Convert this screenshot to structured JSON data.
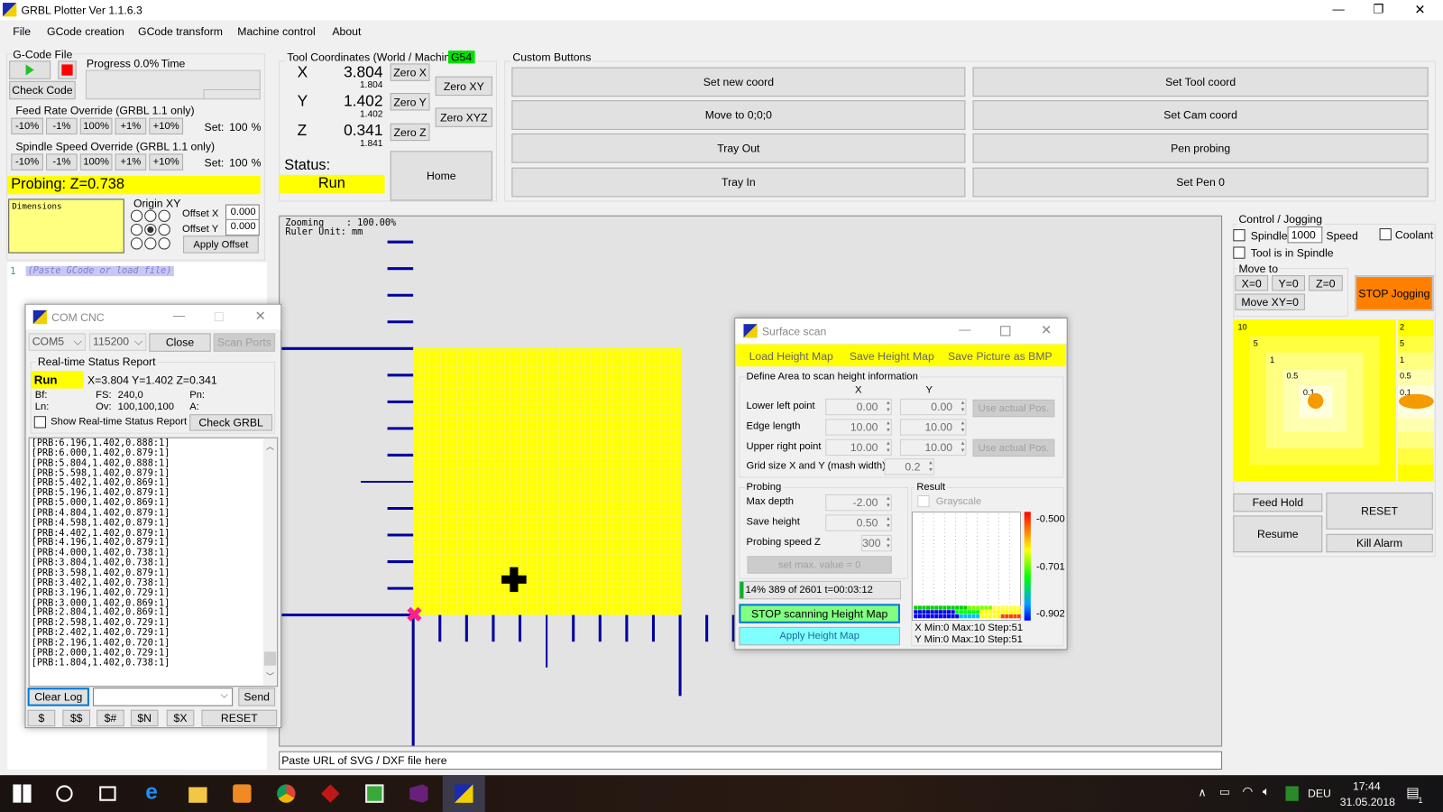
{
  "app": {
    "title": "GRBL Plotter Ver 1.1.6.3",
    "minimize": "—",
    "maximize": "❐",
    "close": "✕"
  },
  "menu": [
    "File",
    "GCode creation",
    "GCode transform",
    "Machine control",
    "About"
  ],
  "gcode": {
    "group": "G-Code File",
    "check_code": "Check Code",
    "progress": "Progress 0.0%",
    "time": "Time"
  },
  "feed": {
    "title": "Feed Rate Override (GRBL 1.1 only)",
    "buttons": [
      "-10%",
      "-1%",
      "100%",
      "+1%",
      "+10%"
    ],
    "set_label": "Set:",
    "set_value": "100",
    "unit": "%"
  },
  "spindle": {
    "title": "Spindle Speed Override (GRBL 1.1 only)",
    "buttons": [
      "-10%",
      "-1%",
      "100%",
      "+1%",
      "+10%"
    ],
    "set_label": "Set:",
    "set_value": "100",
    "unit": "%"
  },
  "probing_status": "Probing: Z=0.738",
  "dimensions": "Dimensions",
  "origin": {
    "title": "Origin XY",
    "selected": 4,
    "offset_x_label": "Offset X",
    "offset_x": "0.000",
    "offset_y_label": "Offset Y",
    "offset_y": "0.000",
    "apply": "Apply Offset"
  },
  "editor": {
    "line_no": "1",
    "placeholder": "(Paste GCode or load file)"
  },
  "tool": {
    "title": "Tool Coordinates (World / Machine)",
    "cs": "G54",
    "x_label": "X",
    "x_world": "3.804",
    "x_machine": "1.804",
    "y_label": "Y",
    "y_world": "1.402",
    "y_machine": "1.402",
    "z_label": "Z",
    "z_world": "0.341",
    "z_machine": "1.841",
    "zero_x": "Zero X",
    "zero_y": "Zero Y",
    "zero_z": "Zero Z",
    "zero_xy": "Zero XY",
    "zero_xyz": "Zero XYZ",
    "status_label": "Status:",
    "status": "Run",
    "home": "Home"
  },
  "custom": {
    "title": "Custom Buttons",
    "buttons": [
      "Set new coord",
      "Set Tool coord",
      "Move to 0;0;0",
      "Set Cam coord",
      "Tray Out",
      "Pen probing",
      "Tray In",
      "Set Pen 0"
    ]
  },
  "canvas": {
    "info1": "Zooming    : 100.00%",
    "info2": "Ruler Unit: mm",
    "url_placeholder": "Paste URL of SVG / DXF file here"
  },
  "com": {
    "title": "COM CNC",
    "port": "COM5",
    "baud": "115200",
    "close": "Close",
    "scan": "Scan Ports",
    "rt_title": "Real-time Status Report",
    "state": "Run",
    "pos": "X=3.804 Y=1.402 Z=0.341",
    "bf": "Bf:",
    "fs_label": "FS:",
    "fs": "240,0",
    "pn": "Pn:",
    "ln": "Ln:",
    "ov_label": "Ov:",
    "ov": "100,100,100",
    "a": "A:",
    "show_rt": "Show Real-time Status Report",
    "check_grbl": "Check GRBL",
    "log": [
      "[PRB:6.196,1.402,0.888:1]",
      "[PRB:6.000,1.402,0.879:1]",
      "[PRB:5.804,1.402,0.888:1]",
      "[PRB:5.598,1.402,0.879:1]",
      "[PRB:5.402,1.402,0.869:1]",
      "[PRB:5.196,1.402,0.879:1]",
      "[PRB:5.000,1.402,0.869:1]",
      "[PRB:4.804,1.402,0.879:1]",
      "[PRB:4.598,1.402,0.879:1]",
      "[PRB:4.402,1.402,0.879:1]",
      "[PRB:4.196,1.402,0.879:1]",
      "[PRB:4.000,1.402,0.738:1]",
      "[PRB:3.804,1.402,0.738:1]",
      "[PRB:3.598,1.402,0.879:1]",
      "[PRB:3.402,1.402,0.738:1]",
      "[PRB:3.196,1.402,0.729:1]",
      "[PRB:3.000,1.402,0.869:1]",
      "[PRB:2.804,1.402,0.869:1]",
      "[PRB:2.598,1.402,0.729:1]",
      "[PRB:2.402,1.402,0.729:1]",
      "[PRB:2.196,1.402,0.720:1]",
      "[PRB:2.000,1.402,0.729:1]",
      "[PRB:1.804,1.402,0.738:1]"
    ],
    "clear_log": "Clear Log",
    "send": "Send",
    "cmds": [
      "$",
      "$$",
      "$#",
      "$N",
      "$X"
    ],
    "reset": "RESET"
  },
  "scan": {
    "title": "Surface scan",
    "menu": [
      "Load Height Map",
      "Save Height Map",
      "Save Picture as BMP"
    ],
    "area_title": "Define Area to scan height information",
    "col_x": "X",
    "col_y": "Y",
    "lower_left": "Lower left point",
    "ll_x": "0.00",
    "ll_y": "0.00",
    "edge": "Edge length",
    "edge_x": "10.00",
    "edge_y": "10.00",
    "upper_right": "Upper right point",
    "ur_x": "10.00",
    "ur_y": "10.00",
    "use_pos": "Use actual Pos.",
    "grid_label": "Grid size X and Y (mash width)",
    "grid": "0.2",
    "probing_title": "Probing",
    "max_depth_label": "Max depth",
    "max_depth": "-2.00",
    "save_height_label": "Save height",
    "save_height": "0.50",
    "speed_label": "Probing speed Z",
    "speed": "300",
    "set_max": "set max. value = 0",
    "progress_text": "14% 389 of 2601  t=00:03:12",
    "progress_percent": 14,
    "stop": "STOP scanning Height Map",
    "apply": "Apply Height Map",
    "result_title": "Result",
    "grayscale": "Grayscale",
    "scale_max": "-0.500",
    "scale_mid": "-0.701",
    "scale_min": "-0.902",
    "x_info": "X Min:0 Max:10 Step:51",
    "y_info": "Y Min:0 Max:10 Step:51"
  },
  "jog": {
    "title": "Control / Jogging",
    "spindle": "Spindle",
    "speed_value": "1000",
    "speed": "Speed",
    "coolant": "Coolant",
    "tool_in_spindle": "Tool is in Spindle",
    "move_to": "Move to",
    "x0": "X=0",
    "y0": "Y=0",
    "z0": "Z=0",
    "xy0": "Move XY=0",
    "stop": "STOP Jogging",
    "pad_labels": [
      "10",
      "5",
      "1",
      "0.5",
      "0.1"
    ],
    "z_labels": [
      "2",
      "5",
      "1",
      "0.5",
      "0.1"
    ],
    "feed_hold": "Feed Hold",
    "resume": "Resume",
    "reset": "RESET",
    "kill": "Kill Alarm"
  },
  "taskbar": {
    "lang": "DEU",
    "time": "17:44",
    "date": "31.05.2018",
    "notif": "1"
  },
  "colors": {
    "accent_yellow": "#ffff00",
    "stop_orange": "#ff8000",
    "ruler_blue": "#0000a0",
    "stop_green": "#80ff80",
    "apply_cyan": "#80ffff",
    "cs_green": "#00e000"
  }
}
